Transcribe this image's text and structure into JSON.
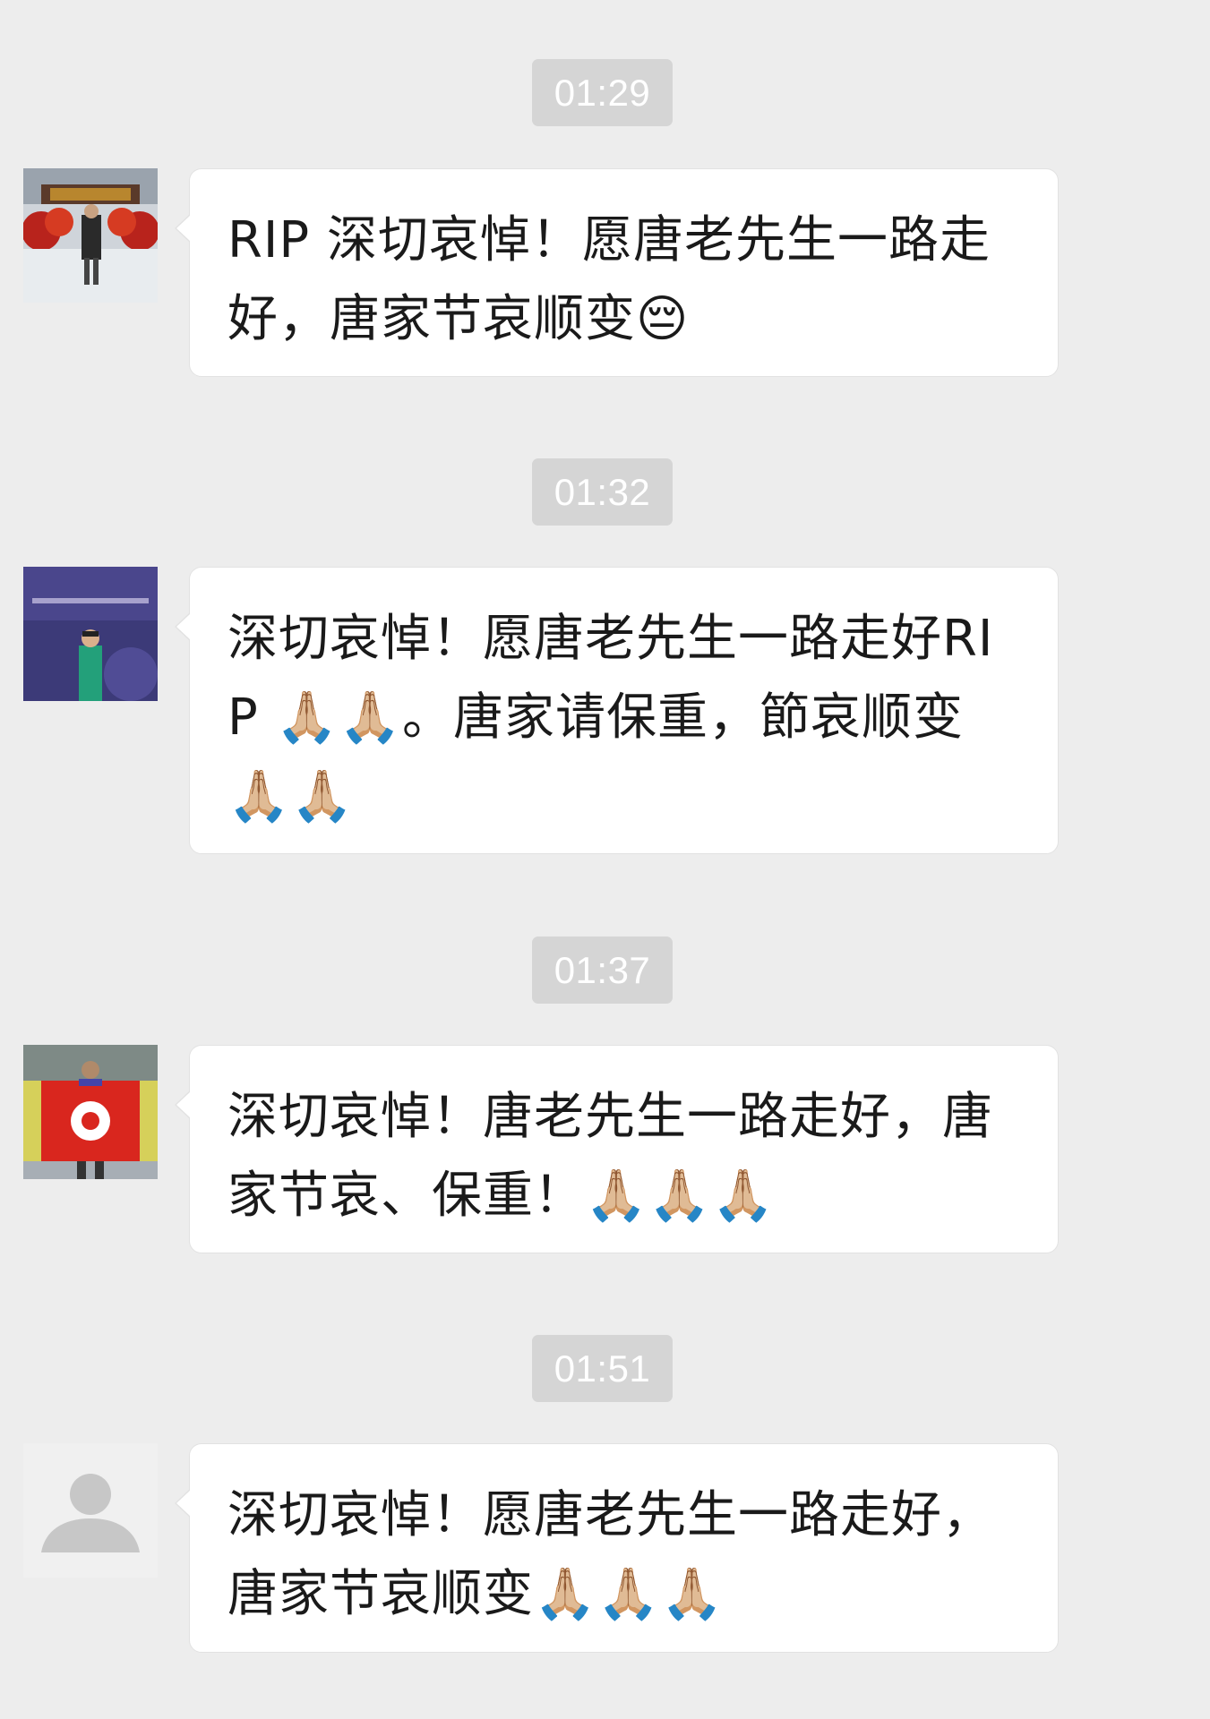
{
  "messages": [
    {
      "time": "01:29",
      "text": "RIP 深切哀悼！愿唐老先生一路走好，唐家节哀顺变😔"
    },
    {
      "time": "01:32",
      "text": "深切哀悼！愿唐老先生一路走好RIP 🙏🏼🙏🏼。唐家请保重，節哀顺变 🙏🏼🙏🏼"
    },
    {
      "time": "01:37",
      "text": "深切哀悼！唐老先生一路走好，唐家节哀、保重！🙏🏼🙏🏼🙏🏼"
    },
    {
      "time": "01:51",
      "text": "深切哀悼！愿唐老先生一路走好，唐家节哀顺变🙏🏼🙏🏼🙏🏼"
    }
  ],
  "avatars": [
    {
      "icon": "avatar-photo-red-gate"
    },
    {
      "icon": "avatar-photo-woman-stage"
    },
    {
      "icon": "avatar-photo-hk-flag"
    },
    {
      "icon": "default-person-icon"
    }
  ],
  "colors": {
    "background": "#ededed",
    "bubble": "#ffffff",
    "timestamp_bg": "#d5d5d5",
    "timestamp_text": "#ffffff",
    "text": "#1a1a1a"
  }
}
